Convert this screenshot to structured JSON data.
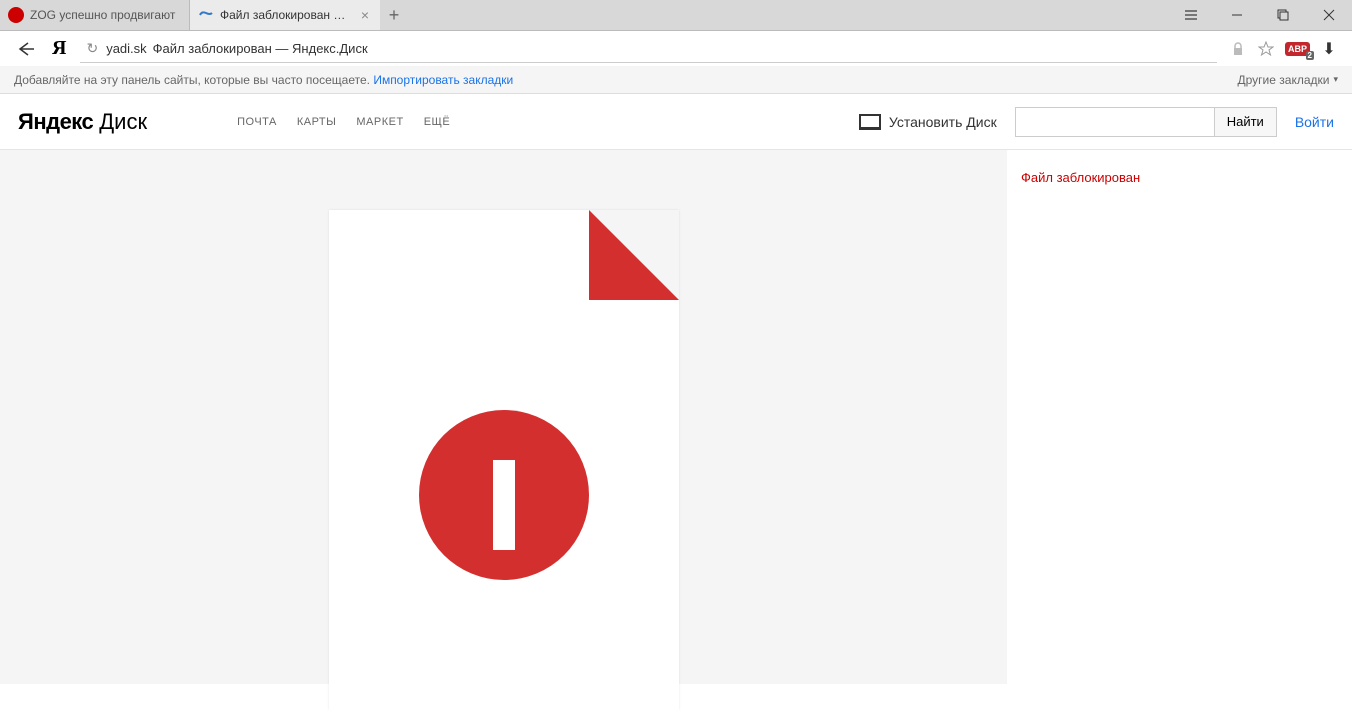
{
  "browser": {
    "tabs": [
      {
        "title": "ZOG успешно продвигают",
        "active": false
      },
      {
        "title": "Файл заблокирован — Я",
        "active": true
      }
    ],
    "address": {
      "host": "yadi.sk",
      "title": "Файл заблокирован — Яндекс.Диск"
    },
    "abp_count": "2",
    "bookmarks": {
      "hint": "Добавляйте на эту панель сайты, которые вы часто посещаете.",
      "import_link": "Импортировать закладки",
      "other": "Другие закладки"
    }
  },
  "yandex_disk": {
    "logo": {
      "yandex": "Яндекс",
      "disk": "Диск"
    },
    "nav": {
      "mail": "ПОЧТА",
      "maps": "КАРТЫ",
      "market": "МАРКЕТ",
      "more": "ЕЩЁ"
    },
    "install": "Установить Диск",
    "search_btn": "Найти",
    "login": "Войти"
  },
  "page": {
    "blocked_message": "Файл заблокирован"
  }
}
